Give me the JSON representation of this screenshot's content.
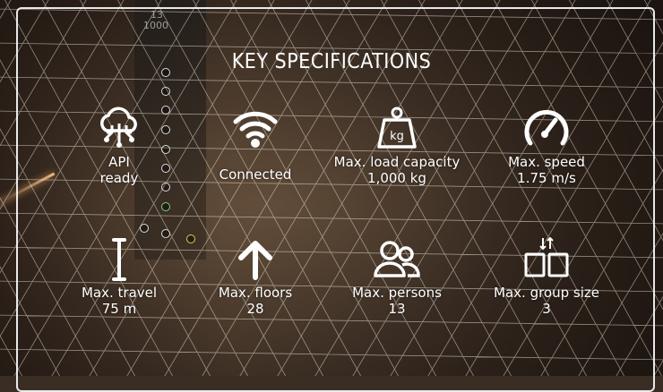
{
  "title": "KEY SPECIFICATIONS",
  "specs": [
    {
      "icon": "cloud-network-icon",
      "label": "API",
      "value": "ready"
    },
    {
      "icon": "wifi-icon",
      "label": "Connected",
      "value": ""
    },
    {
      "icon": "weight-kg-icon",
      "label": "Max. load capacity",
      "value": "1,000 kg"
    },
    {
      "icon": "speedometer-icon",
      "label": "Max. speed",
      "value": "1.75 m/s"
    },
    {
      "icon": "travel-height-icon",
      "label": "Max. travel",
      "value": "75 m"
    },
    {
      "icon": "arrow-up-icon",
      "label": "Max. floors",
      "value": "28"
    },
    {
      "icon": "persons-icon",
      "label": "Max. persons",
      "value": "13"
    },
    {
      "icon": "group-size-icon",
      "label": "Max. group size",
      "value": "3"
    }
  ],
  "background": {
    "panel_text": "1000",
    "panel_sub": "13"
  },
  "colors": {
    "text": "#ffffff",
    "border": "#ffffff"
  }
}
